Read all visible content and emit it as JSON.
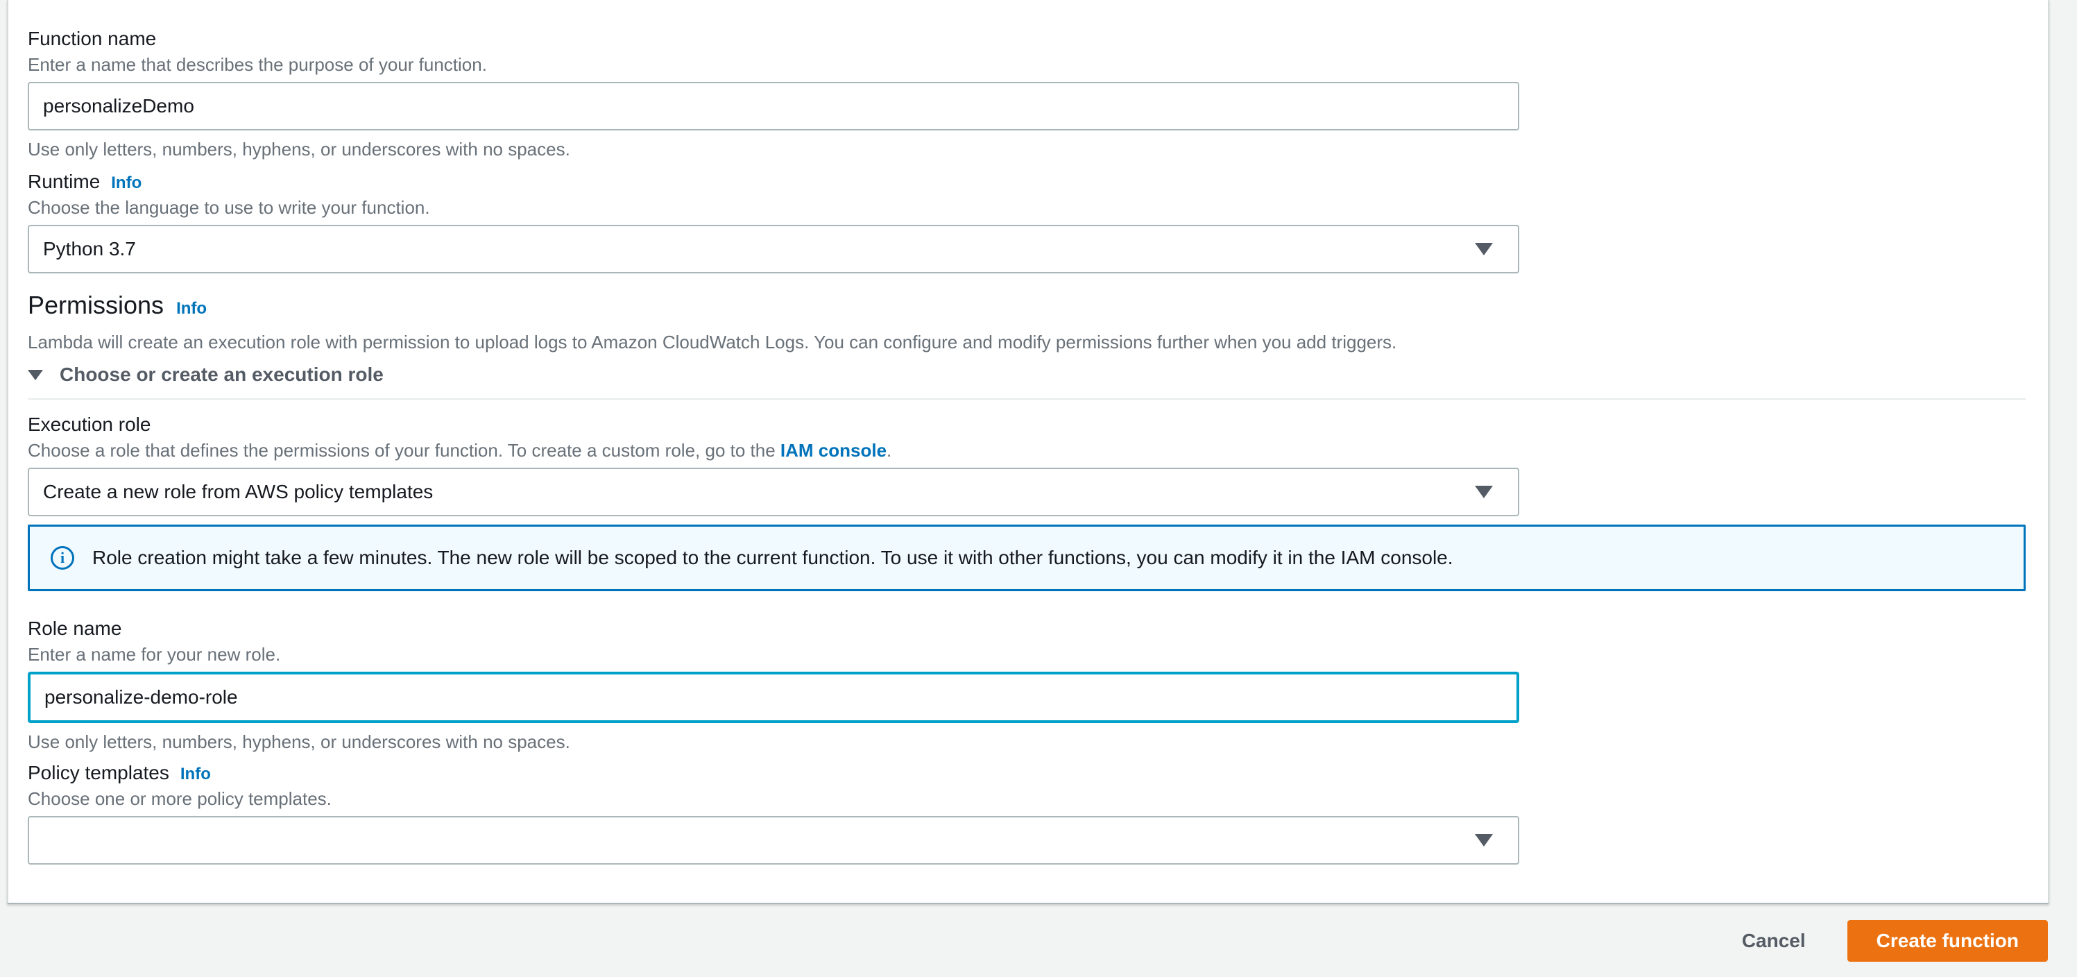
{
  "colors": {
    "page_bg": "#f2f3f3",
    "panel_bg": "#ffffff",
    "link_blue": "#0073bb",
    "focus_border": "#00a1c9",
    "input_border": "#aab7b8",
    "alert_bg": "#f1faff",
    "alert_border": "#0073bb",
    "primary_button_bg": "#ec7211",
    "label_text": "#16191f",
    "muted_text": "#687078",
    "bold_gray_text": "#545b64",
    "divider": "#eaeded"
  },
  "icons": {
    "info_glyph": "i",
    "dropdown_caret": "triangle-down",
    "expander_caret": "triangle-down"
  },
  "form": {
    "function_name": {
      "label": "Function name",
      "description": "Enter a name that describes the purpose of your function.",
      "value": "personalizeDemo",
      "constraint": "Use only letters, numbers, hyphens, or underscores with no spaces."
    },
    "runtime": {
      "label": "Runtime",
      "info_label": "Info",
      "description": "Choose the language to use to write your function.",
      "value": "Python 3.7"
    },
    "permissions": {
      "title": "Permissions",
      "info_label": "Info",
      "description": "Lambda will create an execution role with permission to upload logs to Amazon CloudWatch Logs. You can configure and modify permissions further when you add triggers.",
      "expander_label": "Choose or create an execution role"
    },
    "execution_role": {
      "label": "Execution role",
      "description_prefix": "Choose a role that defines the permissions of your function. To create a custom role, go to the ",
      "link_text": "IAM console",
      "description_suffix": ".",
      "value": "Create a new role from AWS policy templates"
    },
    "role_alert": {
      "text": "Role creation might take a few minutes. The new role will be scoped to the current function. To use it with other functions, you can modify it in the IAM console."
    },
    "role_name": {
      "label": "Role name",
      "description": "Enter a name for your new role.",
      "value": "personalize-demo-role",
      "constraint": "Use only letters, numbers, hyphens, or underscores with no spaces."
    },
    "policy_templates": {
      "label": "Policy templates",
      "info_label": "Info",
      "description": "Choose one or more policy templates.",
      "value": ""
    }
  },
  "footer": {
    "cancel_label": "Cancel",
    "create_label": "Create function"
  }
}
